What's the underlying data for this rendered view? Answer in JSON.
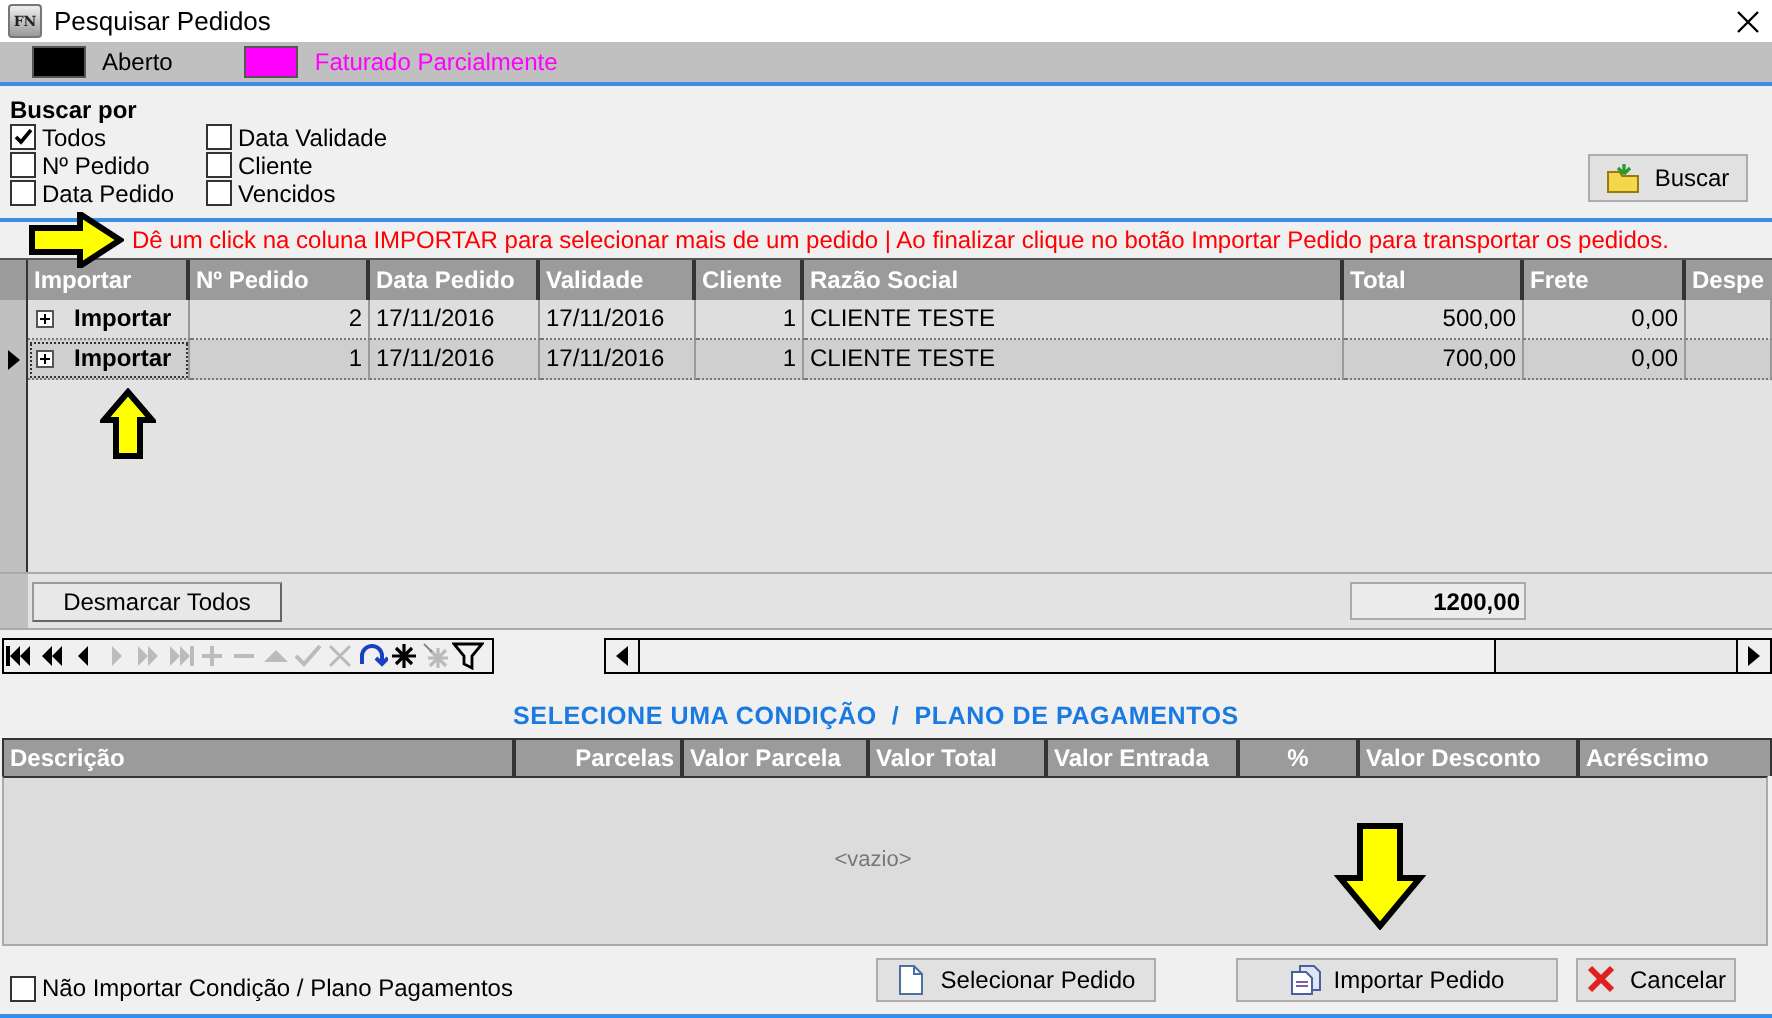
{
  "window": {
    "icon_text": "FN",
    "title": "Pesquisar Pedidos"
  },
  "legend": [
    {
      "label": "Aberto",
      "color": "#000000"
    },
    {
      "label": "Faturado Parcialmente",
      "color": "#ff00ff"
    }
  ],
  "search": {
    "title": "Buscar por",
    "options": [
      {
        "label": "Todos",
        "checked": true
      },
      {
        "label": "Nº Pedido",
        "checked": false
      },
      {
        "label": "Data Pedido",
        "checked": false
      },
      {
        "label": "Data Validade",
        "checked": false
      },
      {
        "label": "Cliente",
        "checked": false
      },
      {
        "label": "Vencidos",
        "checked": false
      }
    ],
    "button": "Buscar"
  },
  "hint": "Dê um click na coluna IMPORTAR para selecionar mais de um pedido  |  Ao finalizar clique no botão Importar Pedido para transportar os pedidos.",
  "orders": {
    "columns": [
      "Importar",
      "Nº Pedido",
      "Data Pedido",
      "Validade",
      "Cliente",
      "Razão Social",
      "Total",
      "Frete",
      "Despe"
    ],
    "rows": [
      {
        "selected": false,
        "cells": [
          "Importar",
          "2",
          "17/11/2016",
          "17/11/2016",
          "1",
          "CLIENTE TESTE",
          "500,00",
          "0,00"
        ]
      },
      {
        "selected": true,
        "cells": [
          "Importar",
          "1",
          "17/11/2016",
          "17/11/2016",
          "1",
          "CLIENTE TESTE",
          "700,00",
          "0,00"
        ]
      }
    ],
    "unmark_button": "Desmarcar Todos",
    "total": "1200,00"
  },
  "payment": {
    "title": "SELECIONE UMA CONDIÇÃO  /  PLANO DE PAGAMENTOS",
    "columns": [
      "Descrição",
      "Parcelas",
      "Valor Parcela",
      "Valor Total",
      "Valor Entrada",
      "%",
      "Valor Desconto",
      "Acréscimo"
    ],
    "empty": "<vazio>"
  },
  "footer": {
    "option": {
      "label": "Não Importar Condição / Plano Pagamentos",
      "checked": false
    },
    "buttons": [
      {
        "label": "Selecionar Pedido",
        "kind": "select"
      },
      {
        "label": "Importar Pedido",
        "kind": "import"
      },
      {
        "label": "Cancelar",
        "kind": "cancel"
      }
    ]
  }
}
